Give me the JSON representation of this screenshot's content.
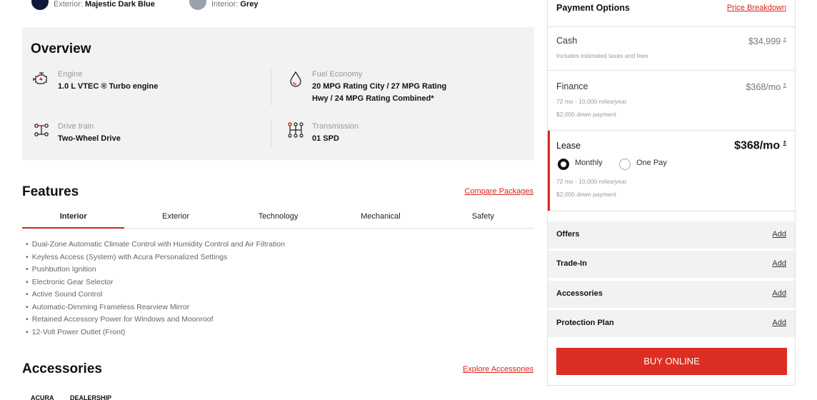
{
  "colors": {
    "exterior_label": "Exterior:",
    "exterior_value": "Majestic Dark Blue",
    "exterior_hex": "#0f1a3a",
    "interior_label": "Interior:",
    "interior_value": "Grey",
    "interior_hex": "#9aa1ae"
  },
  "overview": {
    "title": "Overview",
    "specs": [
      {
        "icon": "engine-icon",
        "label": "Engine",
        "value": "1.0 L VTEC ® Turbo engine"
      },
      {
        "icon": "fuel-drop-icon",
        "label": "Fuel Economy",
        "value_line1": "20 MPG Rating City / 27 MPG Rating",
        "value_line2": "Hwy / 24 MPG Rating Combined*"
      },
      {
        "icon": "drivetrain-icon",
        "label": "Drive train",
        "value": "Two-Wheel Drive"
      },
      {
        "icon": "transmission-icon",
        "label": "Transmission",
        "value": "01 SPD"
      }
    ]
  },
  "features": {
    "title": "Features",
    "compare_link": "Compare Packages",
    "tabs": [
      "Interior",
      "Exterior",
      "Technology",
      "Mechanical",
      "Safety"
    ],
    "active_tab": "Interior",
    "items": [
      "Dual-Zone Automatic Climate Control with Humidity Control and Air Filtration",
      "Keyless Access (System) with Acura Personalized Settings",
      "Pushbutton Ignition",
      "Electronic Gear Selector",
      "Active Sound Control",
      "Automatic-Dimming Frameless Rearview Mirror",
      "Retained Accessory Power for Windows and Moonroof",
      "12-Volt Power Outlet (Front)"
    ]
  },
  "accessories": {
    "title": "Accessories",
    "explore_link": "Explore Accessories",
    "sub_tabs": [
      "ACURA",
      "DEALERSHIP"
    ]
  },
  "payment": {
    "title": "Payment Options",
    "breakdown_link": "Price Breakdown",
    "cash": {
      "label": "Cash",
      "price": "$34,999",
      "note": "Includes estimated taxes and fees"
    },
    "finance": {
      "label": "Finance",
      "price": "$368/mo",
      "term": "72 mo - 10,000 miles/year",
      "down": "$2,000 down payment"
    },
    "lease": {
      "label": "Lease",
      "price": "$368/mo",
      "option_monthly": "Monthly",
      "option_onepay": "One Pay",
      "selected": "Monthly",
      "term": "72 mo - 10,000 miles/year",
      "down": "$2,000 down payment"
    },
    "footnote_mark": "±",
    "addons": [
      {
        "label": "Offers",
        "action": "Add"
      },
      {
        "label": "Trade-In",
        "action": "Add"
      },
      {
        "label": "Accessories",
        "action": "Add"
      },
      {
        "label": "Protection Plan",
        "action": "Add"
      }
    ],
    "buy_label": "BUY ONLINE",
    "accent": "#d9261c"
  }
}
